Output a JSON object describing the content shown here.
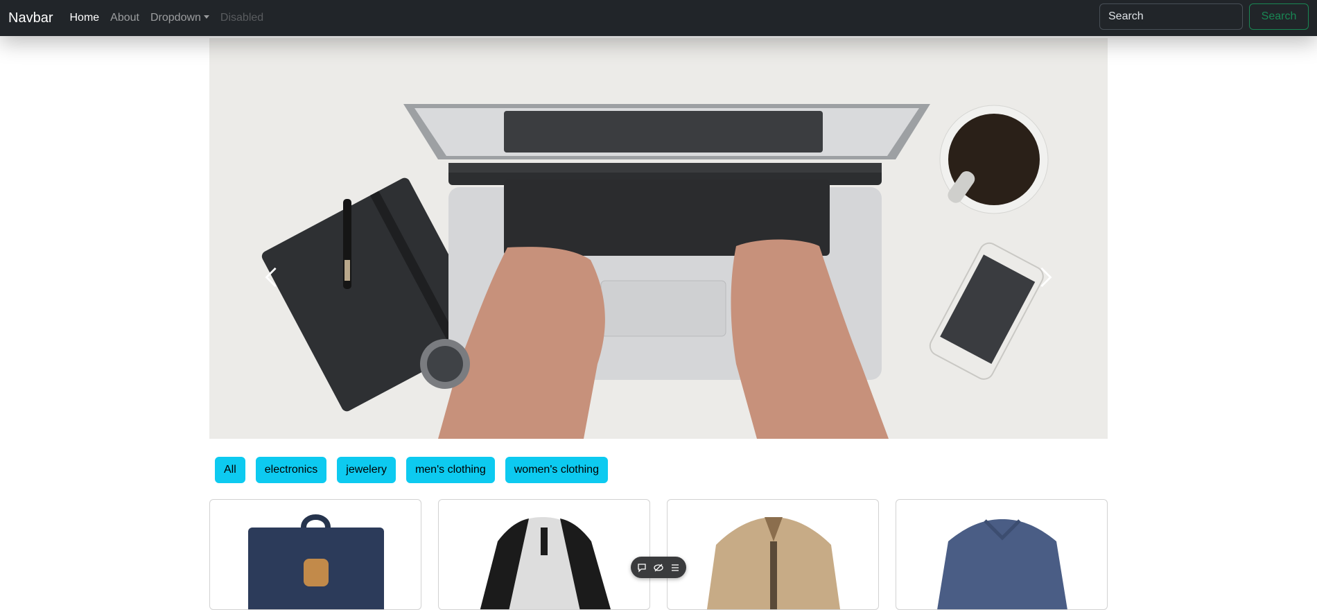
{
  "navbar": {
    "brand": "Navbar",
    "links": {
      "home": "Home",
      "about": "About",
      "dropdown": "Dropdown",
      "disabled": "Disabled"
    },
    "search": {
      "placeholder": "Search",
      "button": "Search"
    }
  },
  "carousel": {
    "prev_icon": "chevron-left-icon",
    "next_icon": "chevron-right-icon"
  },
  "filters": {
    "all": "All",
    "electronics": "electronics",
    "jewelery": "jewelery",
    "mens": "men's clothing",
    "womens": "women's clothing"
  },
  "products": [
    {
      "image": "backpack"
    },
    {
      "image": "raglan-tshirt"
    },
    {
      "image": "jacket"
    },
    {
      "image": "slim-fit-tshirt"
    }
  ],
  "toolbar": {
    "icons": [
      "comment-icon",
      "eye-slash-icon",
      "list-icon"
    ]
  },
  "colors": {
    "navbar_bg": "#212529",
    "search_accent": "#198754",
    "chip_bg": "#0dcaf0"
  }
}
